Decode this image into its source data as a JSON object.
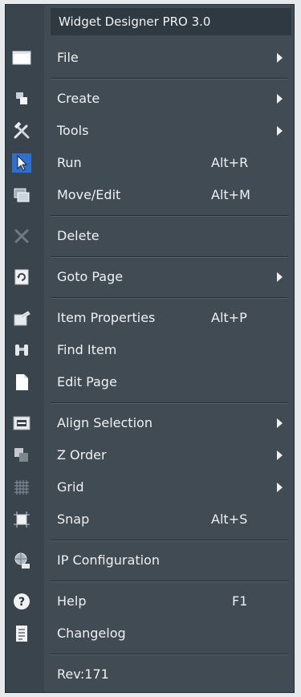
{
  "menu": {
    "title": "Widget Designer PRO 3.0",
    "items": [
      {
        "label": "File",
        "shortcut": "",
        "icon": "window-icon"
      },
      {
        "label": "Create",
        "shortcut": "",
        "icon": "create-icon"
      },
      {
        "label": "Tools",
        "shortcut": "",
        "icon": "tools-icon"
      },
      {
        "label": "Run",
        "shortcut": "Alt+R",
        "icon": "cursor-icon"
      },
      {
        "label": "Move/Edit",
        "shortcut": "Alt+M",
        "icon": "move-edit-icon"
      },
      {
        "label": "Delete",
        "shortcut": "",
        "icon": "delete-icon"
      },
      {
        "label": "Goto Page",
        "shortcut": "",
        "icon": "goto-page-icon"
      },
      {
        "label": "Item Properties",
        "shortcut": "Alt+P",
        "icon": "properties-icon"
      },
      {
        "label": "Find Item",
        "shortcut": "",
        "icon": "binoculars-icon"
      },
      {
        "label": "Edit Page",
        "shortcut": "",
        "icon": "page-icon"
      },
      {
        "label": "Align Selection",
        "shortcut": "",
        "icon": "align-icon"
      },
      {
        "label": "Z Order",
        "shortcut": "",
        "icon": "z-order-icon"
      },
      {
        "label": "Grid",
        "shortcut": "",
        "icon": "grid-icon"
      },
      {
        "label": "Snap",
        "shortcut": "Alt+S",
        "icon": "snap-icon"
      },
      {
        "label": "IP Configuration",
        "shortcut": "",
        "icon": "network-icon"
      },
      {
        "label": "Help",
        "shortcut": "F1",
        "icon": "help-icon"
      },
      {
        "label": "Changelog",
        "shortcut": "",
        "icon": "changelog-icon"
      },
      {
        "label": "Rev:171",
        "shortcut": "",
        "icon": ""
      }
    ]
  },
  "colors": {
    "menu_bg": "#414b54",
    "gutter_bg": "#3a444d",
    "text": "#eef1f3",
    "selected_icon_bg": "#2f6fd1"
  }
}
